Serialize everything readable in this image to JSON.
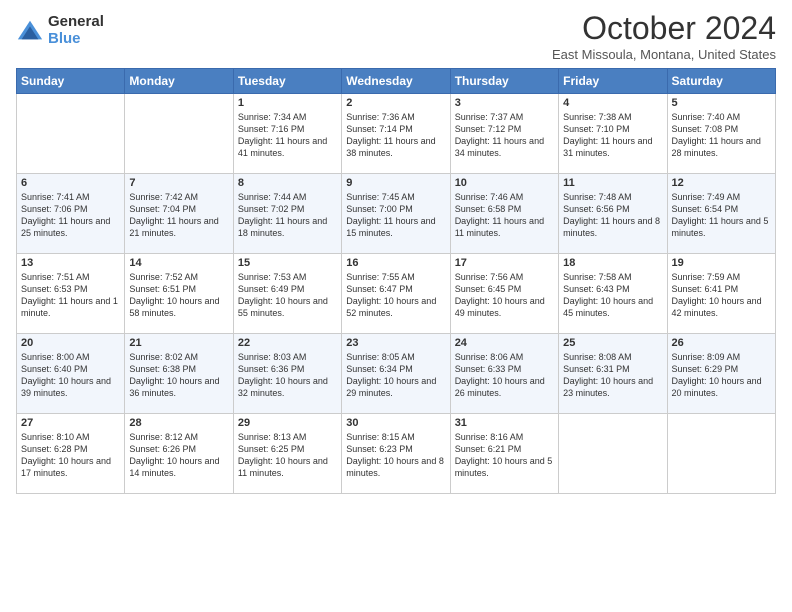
{
  "header": {
    "logo_general": "General",
    "logo_blue": "Blue",
    "month_title": "October 2024",
    "location": "East Missoula, Montana, United States"
  },
  "days_of_week": [
    "Sunday",
    "Monday",
    "Tuesday",
    "Wednesday",
    "Thursday",
    "Friday",
    "Saturday"
  ],
  "weeks": [
    [
      {
        "day": "",
        "info": ""
      },
      {
        "day": "",
        "info": ""
      },
      {
        "day": "1",
        "info": "Sunrise: 7:34 AM\nSunset: 7:16 PM\nDaylight: 11 hours and 41 minutes."
      },
      {
        "day": "2",
        "info": "Sunrise: 7:36 AM\nSunset: 7:14 PM\nDaylight: 11 hours and 38 minutes."
      },
      {
        "day": "3",
        "info": "Sunrise: 7:37 AM\nSunset: 7:12 PM\nDaylight: 11 hours and 34 minutes."
      },
      {
        "day": "4",
        "info": "Sunrise: 7:38 AM\nSunset: 7:10 PM\nDaylight: 11 hours and 31 minutes."
      },
      {
        "day": "5",
        "info": "Sunrise: 7:40 AM\nSunset: 7:08 PM\nDaylight: 11 hours and 28 minutes."
      }
    ],
    [
      {
        "day": "6",
        "info": "Sunrise: 7:41 AM\nSunset: 7:06 PM\nDaylight: 11 hours and 25 minutes."
      },
      {
        "day": "7",
        "info": "Sunrise: 7:42 AM\nSunset: 7:04 PM\nDaylight: 11 hours and 21 minutes."
      },
      {
        "day": "8",
        "info": "Sunrise: 7:44 AM\nSunset: 7:02 PM\nDaylight: 11 hours and 18 minutes."
      },
      {
        "day": "9",
        "info": "Sunrise: 7:45 AM\nSunset: 7:00 PM\nDaylight: 11 hours and 15 minutes."
      },
      {
        "day": "10",
        "info": "Sunrise: 7:46 AM\nSunset: 6:58 PM\nDaylight: 11 hours and 11 minutes."
      },
      {
        "day": "11",
        "info": "Sunrise: 7:48 AM\nSunset: 6:56 PM\nDaylight: 11 hours and 8 minutes."
      },
      {
        "day": "12",
        "info": "Sunrise: 7:49 AM\nSunset: 6:54 PM\nDaylight: 11 hours and 5 minutes."
      }
    ],
    [
      {
        "day": "13",
        "info": "Sunrise: 7:51 AM\nSunset: 6:53 PM\nDaylight: 11 hours and 1 minute."
      },
      {
        "day": "14",
        "info": "Sunrise: 7:52 AM\nSunset: 6:51 PM\nDaylight: 10 hours and 58 minutes."
      },
      {
        "day": "15",
        "info": "Sunrise: 7:53 AM\nSunset: 6:49 PM\nDaylight: 10 hours and 55 minutes."
      },
      {
        "day": "16",
        "info": "Sunrise: 7:55 AM\nSunset: 6:47 PM\nDaylight: 10 hours and 52 minutes."
      },
      {
        "day": "17",
        "info": "Sunrise: 7:56 AM\nSunset: 6:45 PM\nDaylight: 10 hours and 49 minutes."
      },
      {
        "day": "18",
        "info": "Sunrise: 7:58 AM\nSunset: 6:43 PM\nDaylight: 10 hours and 45 minutes."
      },
      {
        "day": "19",
        "info": "Sunrise: 7:59 AM\nSunset: 6:41 PM\nDaylight: 10 hours and 42 minutes."
      }
    ],
    [
      {
        "day": "20",
        "info": "Sunrise: 8:00 AM\nSunset: 6:40 PM\nDaylight: 10 hours and 39 minutes."
      },
      {
        "day": "21",
        "info": "Sunrise: 8:02 AM\nSunset: 6:38 PM\nDaylight: 10 hours and 36 minutes."
      },
      {
        "day": "22",
        "info": "Sunrise: 8:03 AM\nSunset: 6:36 PM\nDaylight: 10 hours and 32 minutes."
      },
      {
        "day": "23",
        "info": "Sunrise: 8:05 AM\nSunset: 6:34 PM\nDaylight: 10 hours and 29 minutes."
      },
      {
        "day": "24",
        "info": "Sunrise: 8:06 AM\nSunset: 6:33 PM\nDaylight: 10 hours and 26 minutes."
      },
      {
        "day": "25",
        "info": "Sunrise: 8:08 AM\nSunset: 6:31 PM\nDaylight: 10 hours and 23 minutes."
      },
      {
        "day": "26",
        "info": "Sunrise: 8:09 AM\nSunset: 6:29 PM\nDaylight: 10 hours and 20 minutes."
      }
    ],
    [
      {
        "day": "27",
        "info": "Sunrise: 8:10 AM\nSunset: 6:28 PM\nDaylight: 10 hours and 17 minutes."
      },
      {
        "day": "28",
        "info": "Sunrise: 8:12 AM\nSunset: 6:26 PM\nDaylight: 10 hours and 14 minutes."
      },
      {
        "day": "29",
        "info": "Sunrise: 8:13 AM\nSunset: 6:25 PM\nDaylight: 10 hours and 11 minutes."
      },
      {
        "day": "30",
        "info": "Sunrise: 8:15 AM\nSunset: 6:23 PM\nDaylight: 10 hours and 8 minutes."
      },
      {
        "day": "31",
        "info": "Sunrise: 8:16 AM\nSunset: 6:21 PM\nDaylight: 10 hours and 5 minutes."
      },
      {
        "day": "",
        "info": ""
      },
      {
        "day": "",
        "info": ""
      }
    ]
  ]
}
